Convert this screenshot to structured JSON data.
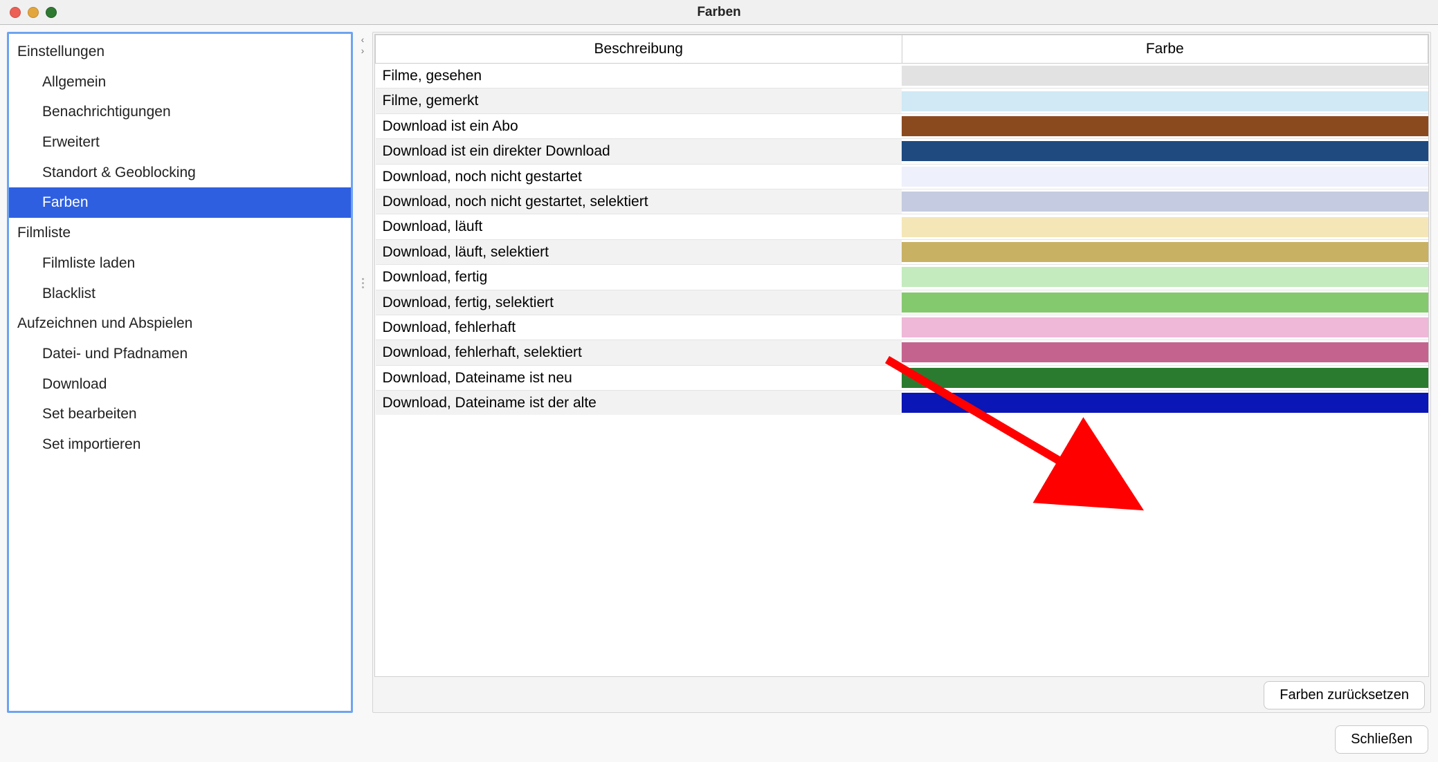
{
  "window": {
    "title": "Farben"
  },
  "sidebar": {
    "groups": [
      {
        "label": "Einstellungen",
        "items": [
          {
            "label": "Allgemein",
            "selected": false
          },
          {
            "label": "Benachrichtigungen",
            "selected": false
          },
          {
            "label": "Erweitert",
            "selected": false
          },
          {
            "label": "Standort & Geoblocking",
            "selected": false
          },
          {
            "label": "Farben",
            "selected": true
          }
        ]
      },
      {
        "label": "Filmliste",
        "items": [
          {
            "label": "Filmliste laden",
            "selected": false
          },
          {
            "label": "Blacklist",
            "selected": false
          }
        ]
      },
      {
        "label": "Aufzeichnen und Abspielen",
        "items": [
          {
            "label": "Datei- und Pfadnamen",
            "selected": false
          },
          {
            "label": "Download",
            "selected": false
          },
          {
            "label": "Set bearbeiten",
            "selected": false
          },
          {
            "label": "Set importieren",
            "selected": false
          }
        ]
      }
    ]
  },
  "table": {
    "headers": {
      "description": "Beschreibung",
      "color": "Farbe"
    },
    "rows": [
      {
        "desc": "Filme, gesehen",
        "color": "#e2e2e2"
      },
      {
        "desc": "Filme, gemerkt",
        "color": "#d0e9f4"
      },
      {
        "desc": "Download ist ein Abo",
        "color": "#8b4a1e"
      },
      {
        "desc": "Download ist ein direkter Download",
        "color": "#1e4a80"
      },
      {
        "desc": "Download, noch nicht gestartet",
        "color": "#eef0fb"
      },
      {
        "desc": "Download, noch nicht gestartet, selektiert",
        "color": "#c5cbe0"
      },
      {
        "desc": "Download, läuft",
        "color": "#f4e6b7"
      },
      {
        "desc": "Download, läuft, selektiert",
        "color": "#c9b164"
      },
      {
        "desc": "Download, fertig",
        "color": "#c4ebbe"
      },
      {
        "desc": "Download, fertig, selektiert",
        "color": "#85c96f"
      },
      {
        "desc": "Download, fehlerhaft",
        "color": "#efb7d8"
      },
      {
        "desc": "Download, fehlerhaft, selektiert",
        "color": "#c4648e"
      },
      {
        "desc": "Download, Dateiname ist neu",
        "color": "#2a7b2f"
      },
      {
        "desc": "Download, Dateiname ist der alte",
        "color": "#0a16b5"
      }
    ]
  },
  "buttons": {
    "reset_colors": "Farben zurücksetzen",
    "close": "Schließen"
  }
}
